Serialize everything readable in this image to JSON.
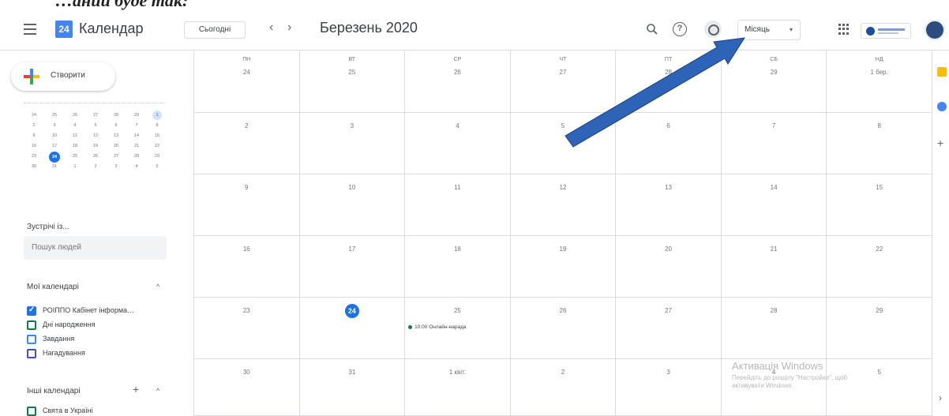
{
  "cutoff_text": "…ании буде так:",
  "header": {
    "logo_day": "24",
    "app_title": "Календар",
    "today_label": "Сьогодні",
    "prev_label": "‹",
    "next_label": "›",
    "month_title": "Березень 2020",
    "help_label": "?",
    "view_label": "Місяць",
    "view_caret": "▾"
  },
  "sidebar": {
    "create_label": "Створити",
    "mini_calendar": {
      "rows": [
        [
          "24",
          "25",
          "26",
          "27",
          "28",
          "29",
          "1"
        ],
        [
          "2",
          "3",
          "4",
          "5",
          "6",
          "7",
          "8"
        ],
        [
          "9",
          "10",
          "11",
          "12",
          "13",
          "14",
          "15"
        ],
        [
          "16",
          "17",
          "18",
          "19",
          "20",
          "21",
          "22"
        ],
        [
          "23",
          "24",
          "25",
          "26",
          "27",
          "28",
          "29"
        ],
        [
          "30",
          "31",
          "1",
          "2",
          "3",
          "4",
          "5"
        ]
      ]
    },
    "meet_label": "Зустрічі із...",
    "search_placeholder": "Пошук людей",
    "my_calendars_label": "Мої календарі",
    "my_calendars": [
      {
        "label": "РОІППО Кабінет інформа…",
        "color": "#1a73e8",
        "checked": true
      },
      {
        "label": "Дні народження",
        "color": "#0b8043",
        "checked": false
      },
      {
        "label": "Завдання",
        "color": "#4285f4",
        "checked": false
      },
      {
        "label": "Нагадування",
        "color": "#3f51b5",
        "checked": false
      }
    ],
    "other_calendars_label": "Інші календарі",
    "other_calendars": [
      {
        "label": "Свята в Україні",
        "color": "#0b8043",
        "checked": false
      }
    ],
    "chevron_up": "^",
    "plus": "+"
  },
  "grid": {
    "weekdays": [
      "ПН",
      "ВТ",
      "СР",
      "ЧТ",
      "ПТ",
      "СБ",
      "НД"
    ],
    "weeks": [
      [
        "24",
        "25",
        "26",
        "27",
        "28",
        "29",
        "1 бер."
      ],
      [
        "2",
        "3",
        "4",
        "5",
        "6",
        "7",
        "8"
      ],
      [
        "9",
        "10",
        "11",
        "12",
        "13",
        "14",
        "15"
      ],
      [
        "16",
        "17",
        "18",
        "19",
        "20",
        "21",
        "22"
      ],
      [
        "23",
        "24",
        "25",
        "26",
        "27",
        "28",
        "29"
      ],
      [
        "30",
        "31",
        "1 квіт.",
        "2",
        "3",
        "4",
        "5"
      ]
    ],
    "today_label": "24",
    "event": {
      "text": "10:00 Онлайн-нарада",
      "color": "#0b8043"
    }
  },
  "watermark": {
    "title": "Активація Windows",
    "line1": "Перейдіть до розділу \"Настройки\", щоб",
    "line2": "активувати Windows."
  },
  "right_rail": {
    "plus": "+",
    "chevron": "›"
  },
  "colors": {
    "accent": "#1a73e8",
    "arrow": "#2e64b8"
  }
}
